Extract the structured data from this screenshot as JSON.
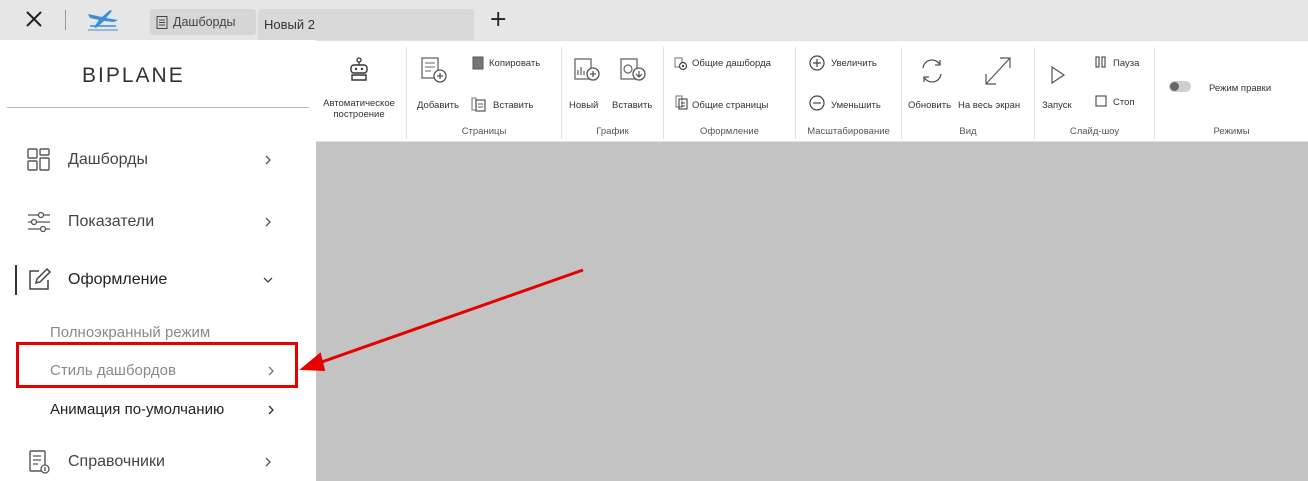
{
  "topbar": {
    "tabs": [
      {
        "label": "Дашборды"
      },
      {
        "label": "Новый 2"
      }
    ]
  },
  "sidebar": {
    "brand": "BIPLANE",
    "items": [
      {
        "label": "Дашборды"
      },
      {
        "label": "Показатели"
      },
      {
        "label": "Оформление"
      },
      {
        "label": "Справочники"
      }
    ],
    "subitems": [
      {
        "label": "Полноэкранный режим"
      },
      {
        "label": "Стиль дашбордов"
      },
      {
        "label": "Анимация по-умолчанию"
      }
    ]
  },
  "ribbon": {
    "auto_build": {
      "line1": "Автоматическое",
      "line2": "построение"
    },
    "pages": {
      "label": "Страницы",
      "add": "Добавить",
      "copy": "Копировать",
      "paste": "Вставить"
    },
    "chart": {
      "label": "График",
      "new": "Новый",
      "paste": "Вставить"
    },
    "design": {
      "label": "Оформление",
      "common_dashboards": "Общие дашборда",
      "common_pages": "Общие страницы"
    },
    "scale": {
      "label": "Масштабирование",
      "zoom_in": "Увеличить",
      "zoom_out": "Уменьшить"
    },
    "view": {
      "label": "Вид",
      "refresh": "Обновить",
      "fullscreen": "На весь экран"
    },
    "slideshow": {
      "label": "Слайд-шоу",
      "start": "Запуск",
      "pause": "Пауза",
      "stop": "Стоп"
    },
    "modes": {
      "label": "Режимы",
      "edit_mode": "Режим правки",
      "edit_mode_on": false
    }
  },
  "colors": {
    "annotation_red": "#e60000",
    "canvas_gray": "#c3c3c3",
    "topbar_gray": "#e6e6e6"
  }
}
